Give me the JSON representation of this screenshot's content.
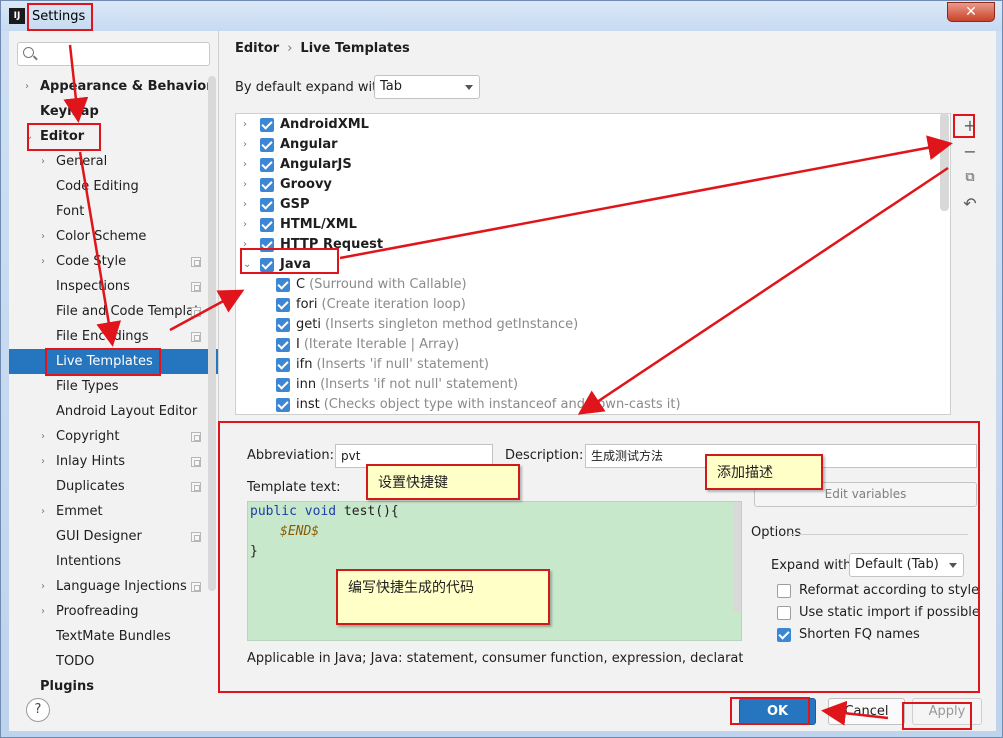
{
  "window": {
    "title": "Settings",
    "close_symbol": "✕",
    "app_icon_text": "IJ"
  },
  "sidebar": {
    "search_placeholder": "",
    "items": [
      {
        "label": "Appearance & Behavior",
        "bold": true,
        "chevron": "›"
      },
      {
        "label": "Keymap",
        "bold": true
      },
      {
        "label": "Editor",
        "bold": true,
        "chevron": "⌄"
      },
      {
        "label": "General",
        "chevron": "›"
      },
      {
        "label": "Code Editing"
      },
      {
        "label": "Font"
      },
      {
        "label": "Color Scheme",
        "chevron": "›"
      },
      {
        "label": "Code Style",
        "chevron": "›",
        "cfg": true
      },
      {
        "label": "Inspections",
        "cfg": true
      },
      {
        "label": "File and Code Templat",
        "cfg": true
      },
      {
        "label": "File Encodings",
        "cfg": true
      },
      {
        "label": "Live Templates",
        "selected": true
      },
      {
        "label": "File Types"
      },
      {
        "label": "Android Layout Editor"
      },
      {
        "label": "Copyright",
        "chevron": "›",
        "cfg": true
      },
      {
        "label": "Inlay Hints",
        "chevron": "›",
        "cfg": true
      },
      {
        "label": "Duplicates",
        "cfg": true
      },
      {
        "label": "Emmet",
        "chevron": "›"
      },
      {
        "label": "GUI Designer",
        "cfg": true
      },
      {
        "label": "Intentions"
      },
      {
        "label": "Language Injections",
        "chevron": "›",
        "cfg": true
      },
      {
        "label": "Proofreading",
        "chevron": "›"
      },
      {
        "label": "TextMate Bundles"
      },
      {
        "label": "TODO"
      },
      {
        "label": "Plugins",
        "bold": true
      }
    ]
  },
  "main": {
    "breadcrumb": {
      "parent": "Editor",
      "separator": "›",
      "current": "Live Templates"
    },
    "expand_label": "By default expand with",
    "expand_value": "Tab",
    "groups": [
      {
        "name": "AndroidXML",
        "expanded": false
      },
      {
        "name": "Angular",
        "expanded": false
      },
      {
        "name": "AngularJS",
        "expanded": false
      },
      {
        "name": "Groovy",
        "expanded": false
      },
      {
        "name": "GSP",
        "expanded": false
      },
      {
        "name": "HTML/XML",
        "expanded": false
      },
      {
        "name": "HTTP Request",
        "expanded": false
      },
      {
        "name": "Java",
        "expanded": true
      }
    ],
    "java_templates": [
      {
        "abbr": "C",
        "desc": "(Surround with Callable)"
      },
      {
        "abbr": "fori",
        "desc": "(Create iteration loop)"
      },
      {
        "abbr": "geti",
        "desc": "(Inserts singleton method getInstance)"
      },
      {
        "abbr": "I",
        "desc": "(Iterate Iterable | Array)"
      },
      {
        "abbr": "ifn",
        "desc": "(Inserts 'if null' statement)"
      },
      {
        "abbr": "inn",
        "desc": "(Inserts 'if not null' statement)"
      },
      {
        "abbr": "inst",
        "desc": "(Checks object type with instanceof and down-casts it)"
      }
    ],
    "toolbar": {
      "add": "+",
      "remove": "−",
      "copy": "⧉",
      "revert": "↶"
    },
    "editor": {
      "abbreviation_label": "Abbreviation:",
      "abbreviation_value": "pvt",
      "description_label": "Description:",
      "description_value": "生成测试方法",
      "template_text_label": "Template text:",
      "code": {
        "kw1": "public",
        "kw2": "void",
        "sig": " test(){",
        "var": "$END$",
        "close": "}"
      },
      "edit_variables": "Edit variables",
      "options_label": "Options",
      "expand_with_label": "Expand with",
      "expand_with_value": "Default (Tab)",
      "options": [
        {
          "label": "Reformat according to style",
          "checked": false
        },
        {
          "label": "Use static import if possible",
          "checked": false
        },
        {
          "label": "Shorten FQ names",
          "checked": true
        }
      ],
      "applicable": "Applicable in Java; Java: statement, consumer function, expression, declaration, comm"
    }
  },
  "footer": {
    "help": "?",
    "ok": "OK",
    "cancel": "Cancel",
    "apply": "Apply"
  },
  "annotations": {
    "set_shortcut": "设置快捷键",
    "add_description": "添加描述",
    "write_code": "编写快捷生成的代码",
    "accent_color": "#e0141b"
  }
}
